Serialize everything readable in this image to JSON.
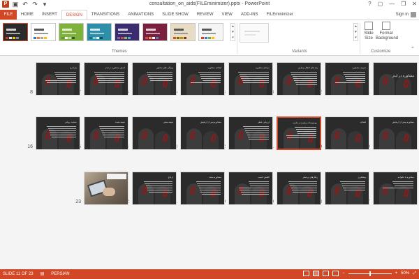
{
  "window": {
    "title": "consultation_on_aids(FILEminimizer).pptx - PowerPoint",
    "controls": [
      "?",
      "▢",
      "—",
      "❐",
      "✕"
    ]
  },
  "qat": {
    "app_icon": "P",
    "save_icon": "save-icon",
    "undo_icon": "undo-icon",
    "redo_icon": "redo-icon"
  },
  "tabs": [
    {
      "label": "FILE"
    },
    {
      "label": "HOME"
    },
    {
      "label": "INSERT"
    },
    {
      "label": "DESIGN"
    },
    {
      "label": "TRANSITIONS"
    },
    {
      "label": "ANIMATIONS"
    },
    {
      "label": "SLIDE SHOW"
    },
    {
      "label": "REVIEW"
    },
    {
      "label": "VIEW"
    },
    {
      "label": "ADD-INS"
    },
    {
      "label": "FILEminimizer"
    }
  ],
  "active_tab": "DESIGN",
  "signin": {
    "label": "Sign in"
  },
  "ribbon": {
    "themes_label": "Themes",
    "variants_label": "Variants",
    "customize_label": "Customize",
    "slide_size_label": "Slide Size",
    "format_background_label": "Format Background",
    "themes": [
      {
        "bg": "#2b2b2b",
        "colors": [
          "#c0392b",
          "#e6e6e6",
          "#f1c40f",
          "#7f8c8d"
        ]
      },
      {
        "bg": "#ffffff",
        "colors": [
          "#2e75b6",
          "#ed7d31",
          "#a5a5a5",
          "#ffc000"
        ]
      },
      {
        "bg": "#7fb23a",
        "colors": [
          "#5b9b2b",
          "#ffffff",
          "#c6e0b4",
          "#375623"
        ]
      },
      {
        "bg": "#2e8fa8",
        "colors": [
          "#1b6f84",
          "#7fd1e0",
          "#ffffff",
          "#0e4c5b"
        ]
      },
      {
        "bg": "#3a2c6e",
        "colors": [
          "#8064a2",
          "#c0504d",
          "#9bbb59",
          "#4bacc6"
        ]
      },
      {
        "bg": "#7a1f3d",
        "colors": [
          "#c0504d",
          "#f79646",
          "#ffffff",
          "#4f81bd"
        ]
      },
      {
        "bg": "#e8dcc4",
        "colors": [
          "#c55a11",
          "#7f6000",
          "#bf9000",
          "#843c0c"
        ]
      },
      {
        "bg": "#f5f5f5",
        "colors": [
          "#d24726",
          "#4472c4",
          "#70ad47",
          "#ffc000"
        ]
      }
    ]
  },
  "slides": [
    {
      "num": "1",
      "title": "مشاوره در ایدز",
      "big": true,
      "lines": 0,
      "selected": false
    },
    {
      "num": "2",
      "title": "تعریف مشاوره",
      "lines": 6,
      "selected": false
    },
    {
      "num": "3",
      "title": "راه های انتقال بیماری",
      "lines": 7,
      "selected": false
    },
    {
      "num": "4",
      "title": "مراحل مشاوره",
      "lines": 6,
      "selected": false
    },
    {
      "num": "5",
      "title": "اهداف مشاوره",
      "lines": 6,
      "selected": false
    },
    {
      "num": "6",
      "title": "ویژگی های مشاور",
      "lines": 5,
      "selected": false
    },
    {
      "num": "7",
      "title": "اصول مشاوره در ایدز",
      "lines": 6,
      "selected": false
    },
    {
      "num": "8",
      "title": "رازداری",
      "lines": 6,
      "selected": false
    },
    {
      "num": "9",
      "title": "مشاوره پیش از آزمایش",
      "lines": 0,
      "selected": false
    },
    {
      "num": "10",
      "title": "اهداف",
      "lines": 0,
      "selected": false
    },
    {
      "num": "11",
      "title": "موضوعات مطرح در جلسه",
      "lines": 6,
      "selected": true
    },
    {
      "num": "12",
      "title": "ارزیابی خطر",
      "lines": 7,
      "selected": false
    },
    {
      "num": "13",
      "title": "مشاوره پس از آزمایش",
      "lines": 0,
      "selected": false
    },
    {
      "num": "14",
      "title": "نتیجه منفی",
      "lines": 0,
      "selected": false
    },
    {
      "num": "15",
      "title": "نتیجه مثبت",
      "lines": 6,
      "selected": false
    },
    {
      "num": "16",
      "title": "حمایت روانی",
      "lines": 6,
      "selected": false
    },
    {
      "num": "17",
      "title": "مشاوره با خانواده",
      "lines": 4,
      "selected": false
    },
    {
      "num": "18",
      "title": "پیشگیری",
      "lines": 5,
      "selected": false
    },
    {
      "num": "19",
      "title": "رفتارهای پرخطر",
      "lines": 6,
      "selected": false
    },
    {
      "num": "20",
      "title": "کاهش آسیب",
      "lines": 7,
      "selected": false
    },
    {
      "num": "21",
      "title": "مشاوره مجدد",
      "lines": 7,
      "selected": false
    },
    {
      "num": "22",
      "title": "ارجاع",
      "lines": 6,
      "selected": false
    },
    {
      "num": "23",
      "title": "",
      "photo": true,
      "selected": false
    }
  ],
  "status": {
    "slide_info": "SLIDE 11 OF 23",
    "language": "PERSIAN",
    "zoom": "50%",
    "zoom_fraction": 0.5,
    "plus": "+",
    "minus": "−"
  },
  "colors": {
    "accent": "#d24726"
  }
}
